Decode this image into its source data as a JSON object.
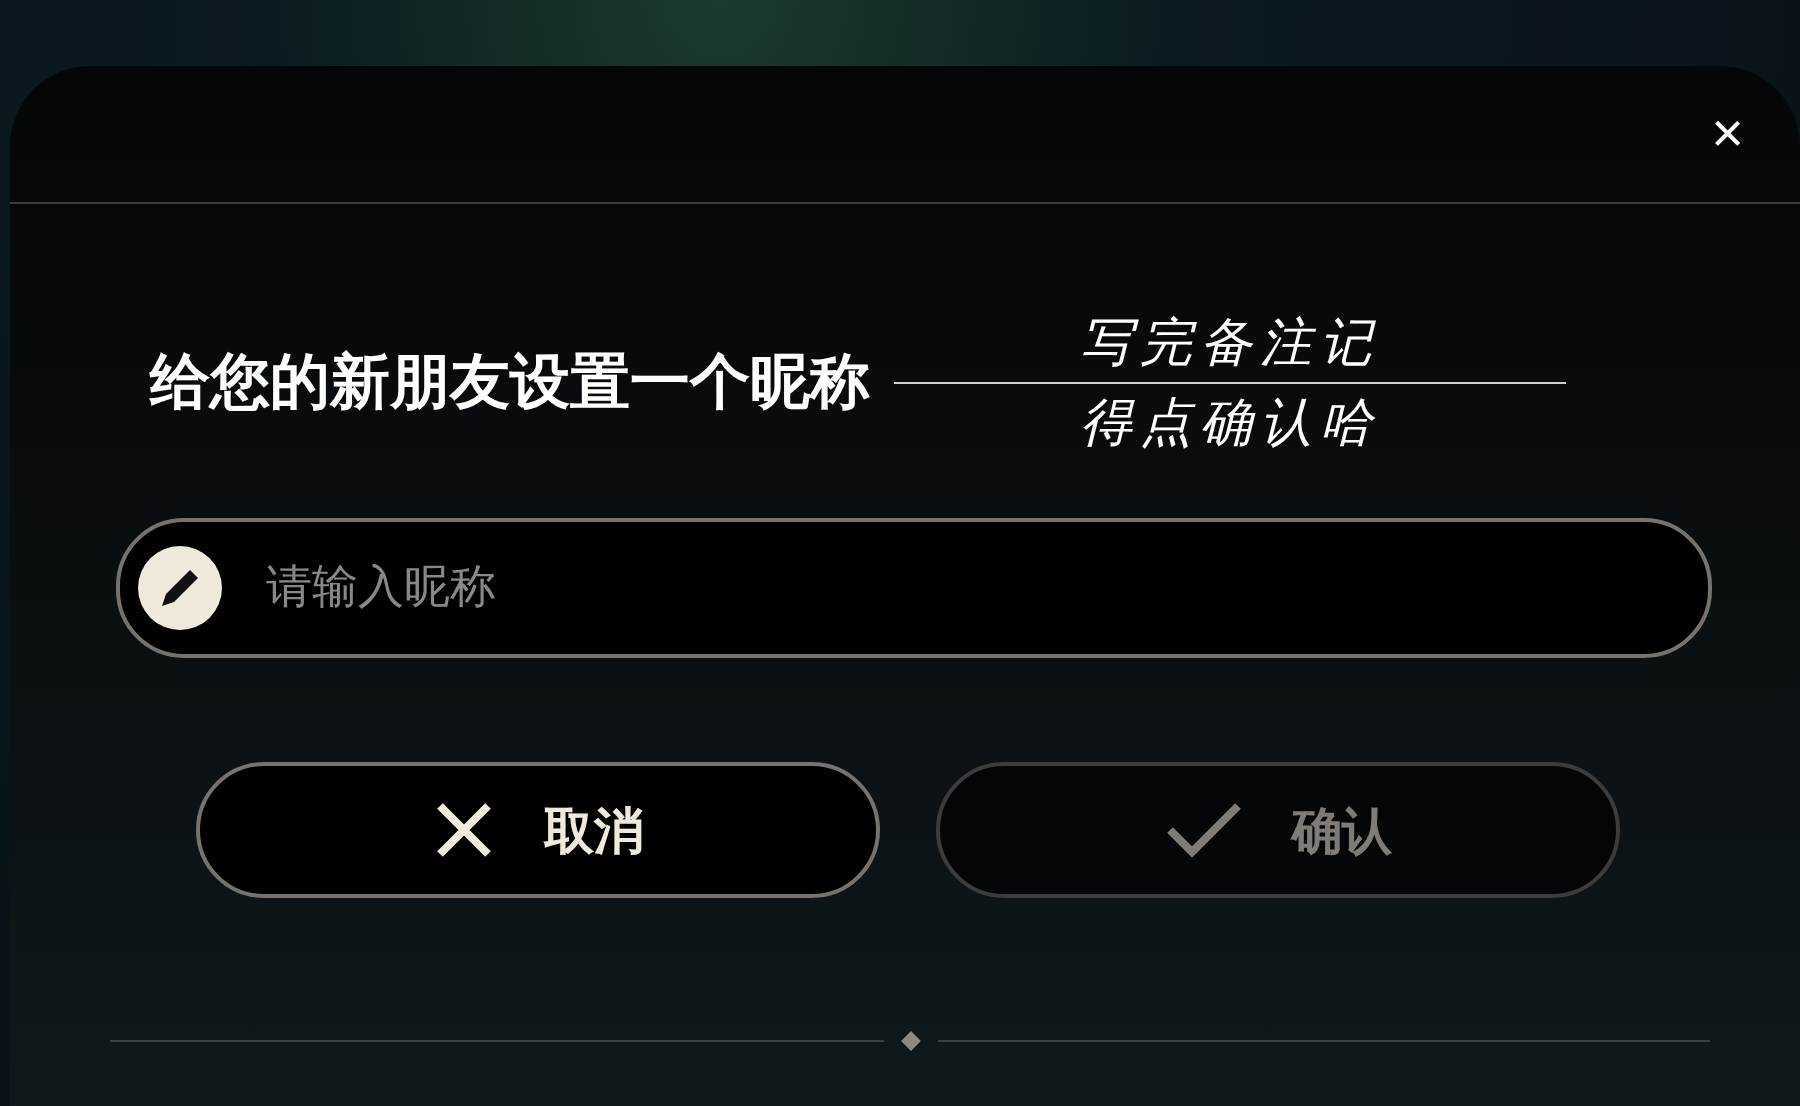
{
  "dialog": {
    "close_label": "×",
    "title": "给您的新朋友设置一个昵称",
    "annotation": [
      "写完备注记",
      "得点确认哈"
    ],
    "nickname_field": {
      "placeholder": "请输入昵称"
    },
    "buttons": [
      {
        "kind": "cancel",
        "label": "取消",
        "disabled": false
      },
      {
        "kind": "confirm",
        "label": "确认",
        "disabled": true
      }
    ]
  }
}
